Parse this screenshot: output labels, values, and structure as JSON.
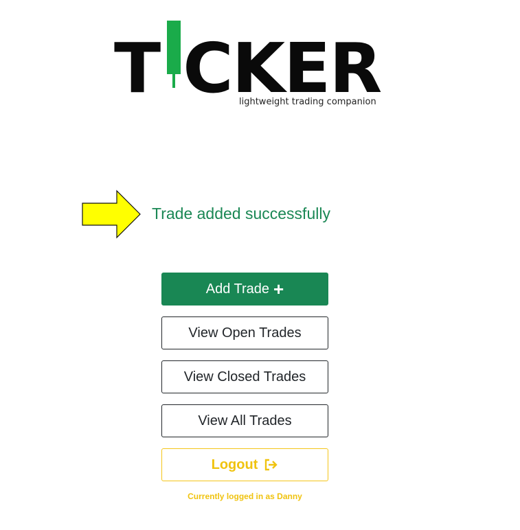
{
  "logo": {
    "wordmark_left": "T",
    "wordmark_right": "CKER",
    "tagline": "lightweight trading companion",
    "accent_color": "#1aab4a"
  },
  "flash": {
    "message": "Trade added successfully",
    "arrow_icon": "arrow-right-icon",
    "arrow_color": "#ffff00"
  },
  "menu": {
    "add_trade": "Add Trade",
    "add_icon": "plus-icon",
    "view_open": "View Open Trades",
    "view_closed": "View Closed Trades",
    "view_all": "View All Trades",
    "logout": "Logout",
    "logout_icon": "logout-icon"
  },
  "status": {
    "logged_in": "Currently logged in as Danny"
  },
  "colors": {
    "success": "#198754",
    "warning": "#f0c30f",
    "text": "#212529"
  }
}
